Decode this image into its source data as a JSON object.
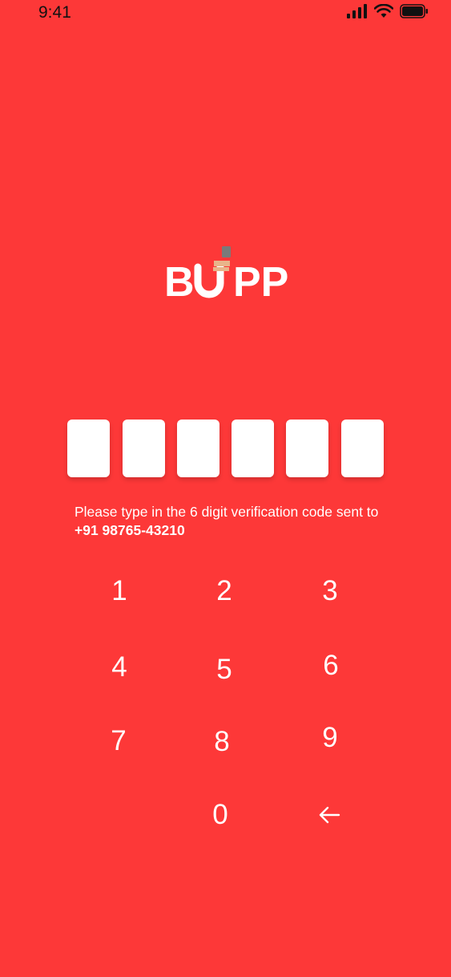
{
  "status_bar": {
    "time": "9:41",
    "icons": [
      "signal-icon",
      "wifi-icon",
      "battery-icon"
    ]
  },
  "logo": {
    "text": "BUPP"
  },
  "otp": {
    "boxes": [
      "",
      "",
      "",
      "",
      "",
      ""
    ]
  },
  "instruction": {
    "prefix": "Please type in the 6 digit verification code sent to ",
    "phone": "+91 98765-43210"
  },
  "keypad": {
    "keys": [
      "1",
      "2",
      "3",
      "4",
      "5",
      "6",
      "7",
      "8",
      "9",
      "0"
    ],
    "backspace_icon": "arrow-left-icon"
  },
  "colors": {
    "background": "#fd3838",
    "text": "#ffffff",
    "box": "#ffffff"
  }
}
